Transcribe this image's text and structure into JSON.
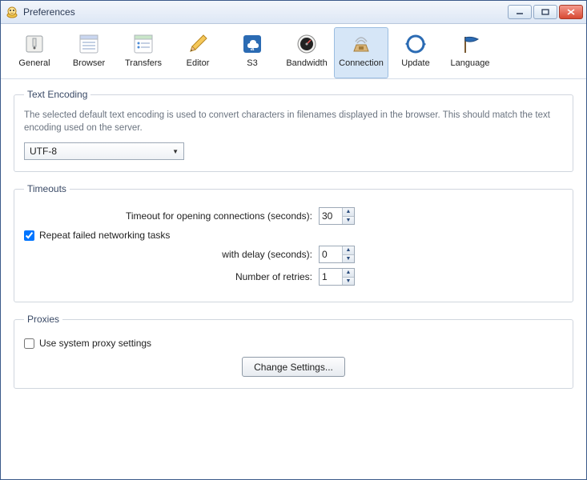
{
  "window": {
    "title": "Preferences"
  },
  "toolbar": {
    "active": "connection",
    "items": [
      {
        "id": "general",
        "label": "General"
      },
      {
        "id": "browser",
        "label": "Browser"
      },
      {
        "id": "transfers",
        "label": "Transfers"
      },
      {
        "id": "editor",
        "label": "Editor"
      },
      {
        "id": "s3",
        "label": "S3"
      },
      {
        "id": "bandwidth",
        "label": "Bandwidth"
      },
      {
        "id": "connection",
        "label": "Connection"
      },
      {
        "id": "update",
        "label": "Update"
      },
      {
        "id": "language",
        "label": "Language"
      }
    ]
  },
  "encoding": {
    "legend": "Text Encoding",
    "description": "The selected default text encoding is used to convert characters in filenames displayed in the browser. This should match the text encoding used on the server.",
    "value": "UTF-8"
  },
  "timeouts": {
    "legend": "Timeouts",
    "timeout_label": "Timeout for opening connections (seconds):",
    "timeout_value": "30",
    "repeat_label": "Repeat failed networking tasks",
    "repeat_checked": true,
    "delay_label": "with delay (seconds):",
    "delay_value": "0",
    "retries_label": "Number of retries:",
    "retries_value": "1"
  },
  "proxies": {
    "legend": "Proxies",
    "use_system_label": "Use system proxy settings",
    "use_system_checked": false,
    "change_button": "Change Settings..."
  }
}
